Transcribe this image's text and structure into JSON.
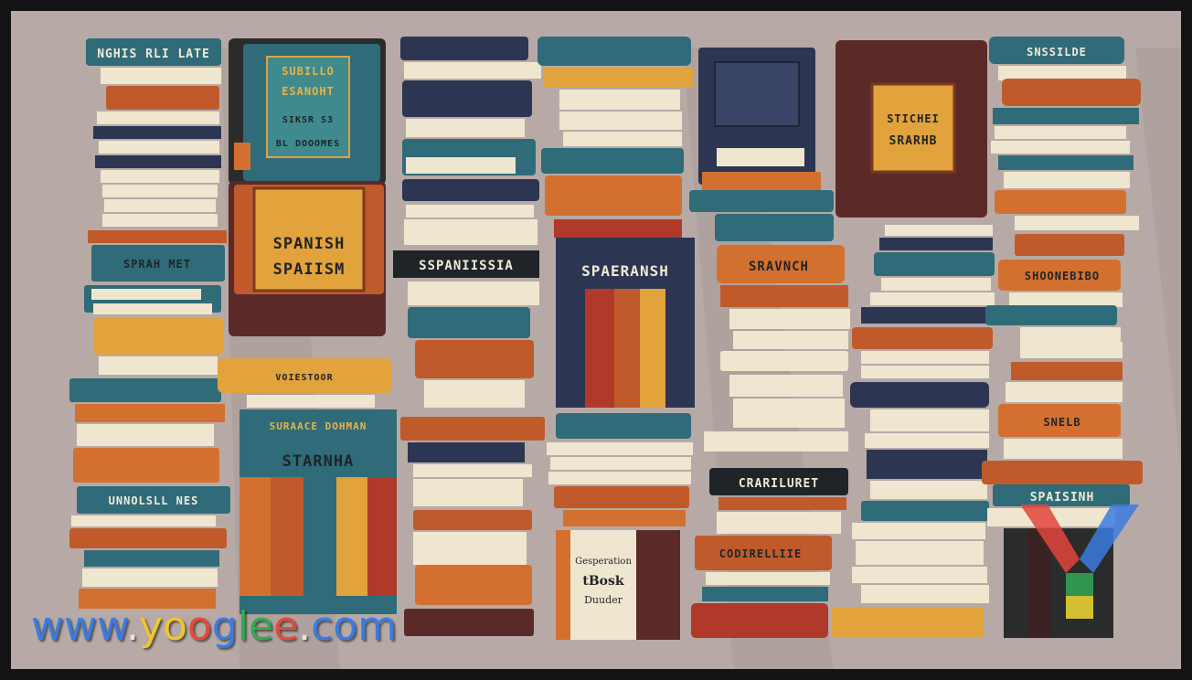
{
  "image": {
    "subject": "stacks of books",
    "palette": {
      "background": "#b7aaa6",
      "teal": "#2f6b78",
      "navy": "#2c3552",
      "orange": "#d4702f",
      "burnt_orange": "#c05a2b",
      "cream": "#efe6cf",
      "maroon": "#5b2a28",
      "gold": "#e2a23c",
      "red": "#b0392a"
    }
  },
  "book_labels": {
    "stack1_top": "NGHIS RLI LATE",
    "stack1_mid": "SPRAH MET",
    "stack1_low": "UNNOLSLL NES",
    "stack2_box1_line1": "SUBILLO",
    "stack2_box1_line2": "ESANOHT",
    "stack2_box1_line3": "SIKSR S3",
    "stack2_box1_line4": "BL DOOOMES",
    "stack2_box2_line1": "SPANISH",
    "stack2_box2_line2": "SPAIISM",
    "stack2_lower_top": "VOIESTOOR",
    "stack2_lower_banner": "SURAACE DOHMAN",
    "stack2_lower_title": "STARNHA",
    "stack3_banner": "SSPANIISSIA",
    "stack4_banner": "SPAERANSH",
    "stack4_book_line1": "Gesperation",
    "stack4_book_line2": "tBosk",
    "stack4_book_line3": "Duuder",
    "stack5_banner1": "SRAVNCH",
    "stack5_banner2": "CRARILURET",
    "stack5_banner3": "CODIRELLIIE",
    "stack6_box_line1": "STICHEI",
    "stack6_box_line2": "SRARHB",
    "stack7_top": "SNSSILDE",
    "stack7_mid": "SHOONEBIBO",
    "stack7_low": "SNELB",
    "stack7_banner": "SPAISINH"
  },
  "watermark": {
    "letters": [
      "w",
      "w",
      "w",
      ".",
      "y",
      "o",
      "o",
      "g",
      "l",
      "e",
      "e",
      ".",
      "c",
      "o",
      "m"
    ],
    "colors": [
      "#3b7be0",
      "#3b7be0",
      "#3b7be0",
      "#e6e6e6",
      "#f0c630",
      "#f0c630",
      "#e44b3b",
      "#3b7be0",
      "#34a853",
      "#34a853",
      "#e44b3b",
      "#e6e6e6",
      "#3b7be0",
      "#3b7be0",
      "#3b7be0"
    ],
    "logo_colors": [
      "#e2453c",
      "#3b7be0",
      "#34a853",
      "#f0c630"
    ]
  }
}
